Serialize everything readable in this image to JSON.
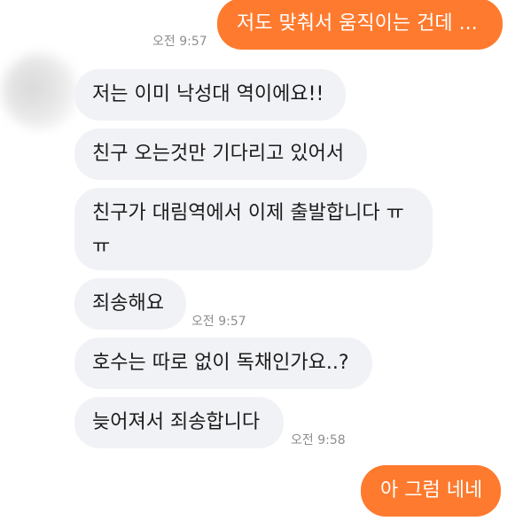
{
  "messages": {
    "out1": {
      "text": "저도 맞춰서 움직이는 건데 ...",
      "time": "오전 9:57"
    },
    "in1": {
      "text": "저는 이미 낙성대 역이에요!!"
    },
    "in2": {
      "text": "친구 오는것만 기다리고 있어서"
    },
    "in3": {
      "text": "친구가 대림역에서 이제 출발합니다 ㅠ ㅠ"
    },
    "in4": {
      "text": "죄송해요",
      "time": "오전 9:57"
    },
    "in5": {
      "text": "호수는 따로 없이 독채인가요..?"
    },
    "in6": {
      "text": "늦어져서 죄송합니다",
      "time": "오전 9:58"
    },
    "out2": {
      "text": "아 그럼 네네"
    }
  },
  "colors": {
    "outgoing_bubble": "#fe7a2e",
    "incoming_bubble": "#f1f2f6",
    "timestamp": "#8e8e93"
  }
}
